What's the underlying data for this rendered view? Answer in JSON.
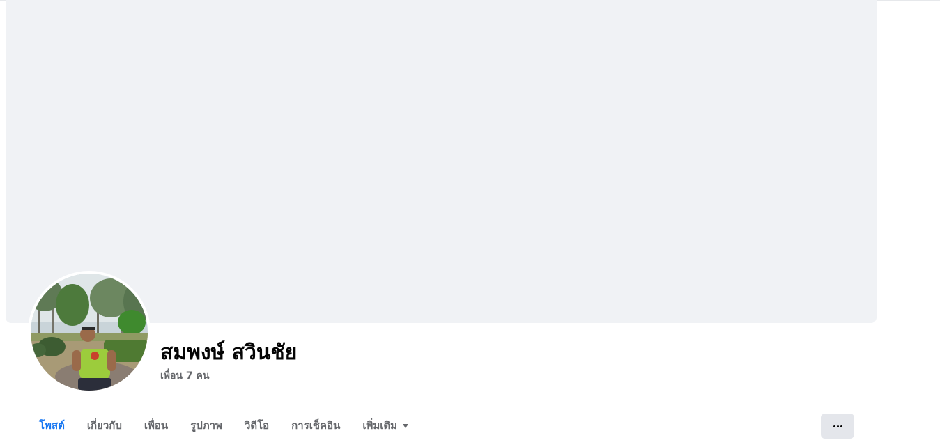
{
  "profile": {
    "name": "สมพงษ์ สวินชัย",
    "friends": "เพื่อน 7 คน"
  },
  "tabs": [
    {
      "label": "โพสต์",
      "active": true
    },
    {
      "label": "เกี่ยวกับ",
      "active": false
    },
    {
      "label": "เพื่อน",
      "active": false
    },
    {
      "label": "รูปภาพ",
      "active": false
    },
    {
      "label": "วิดีโอ",
      "active": false
    },
    {
      "label": "การเช็คอิน",
      "active": false
    },
    {
      "label": "เพิ่มเติม",
      "active": false,
      "has_dropdown": true
    }
  ],
  "icons": {
    "more_options": "ellipsis-icon",
    "dropdown": "caret-down-icon"
  },
  "colors": {
    "active_tab": "#1877f2",
    "inactive_tab": "#65676b",
    "cover_bg": "#f0f2f5",
    "button_bg": "#e4e6eb"
  }
}
